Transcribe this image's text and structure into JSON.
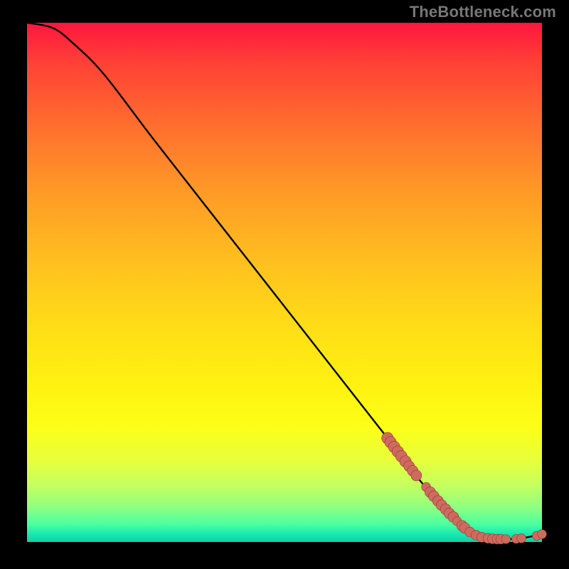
{
  "watermark": "TheBottleneck.com",
  "colors": {
    "frame_bg": "#000000",
    "curve": "#000000",
    "dot_fill": "#cf6a5e",
    "dot_stroke": "#8a3c33"
  },
  "chart_data": {
    "type": "line",
    "title": "",
    "xlabel": "",
    "ylabel": "",
    "xlim": [
      0,
      100
    ],
    "ylim": [
      0,
      100
    ],
    "grid": false,
    "series": [
      {
        "name": "curve",
        "x": [
          0,
          5,
          9,
          15,
          25,
          40,
          55,
          70,
          77,
          82,
          85,
          88,
          90,
          95,
          100
        ],
        "y": [
          100,
          99,
          96,
          90,
          77,
          58,
          39,
          20,
          11,
          6,
          3,
          1.5,
          0.8,
          0.6,
          1.5
        ]
      }
    ],
    "dots": [
      {
        "x": 70.0,
        "y": 20.0,
        "r": 1.4
      },
      {
        "x": 70.6,
        "y": 19.2,
        "r": 1.4
      },
      {
        "x": 71.3,
        "y": 18.3,
        "r": 1.4
      },
      {
        "x": 72.0,
        "y": 17.4,
        "r": 1.4
      },
      {
        "x": 72.7,
        "y": 16.5,
        "r": 1.4
      },
      {
        "x": 73.5,
        "y": 15.5,
        "r": 1.4
      },
      {
        "x": 74.2,
        "y": 14.6,
        "r": 1.3
      },
      {
        "x": 74.9,
        "y": 13.7,
        "r": 1.3
      },
      {
        "x": 75.6,
        "y": 12.8,
        "r": 1.3
      },
      {
        "x": 77.5,
        "y": 10.6,
        "r": 1.1
      },
      {
        "x": 78.3,
        "y": 9.6,
        "r": 1.3
      },
      {
        "x": 79.0,
        "y": 8.8,
        "r": 1.3
      },
      {
        "x": 79.8,
        "y": 7.9,
        "r": 1.3
      },
      {
        "x": 80.5,
        "y": 7.1,
        "r": 1.3
      },
      {
        "x": 81.3,
        "y": 6.3,
        "r": 1.3
      },
      {
        "x": 82.0,
        "y": 5.5,
        "r": 1.3
      },
      {
        "x": 82.8,
        "y": 4.8,
        "r": 1.3
      },
      {
        "x": 83.5,
        "y": 4.0,
        "r": 1.1
      },
      {
        "x": 84.5,
        "y": 3.1,
        "r": 1.3
      },
      {
        "x": 85.0,
        "y": 2.7,
        "r": 1.3
      },
      {
        "x": 86.0,
        "y": 1.9,
        "r": 1.2
      },
      {
        "x": 87.2,
        "y": 1.3,
        "r": 1.2
      },
      {
        "x": 88.3,
        "y": 0.9,
        "r": 1.2
      },
      {
        "x": 89.5,
        "y": 0.7,
        "r": 1.2
      },
      {
        "x": 90.4,
        "y": 0.6,
        "r": 1.2
      },
      {
        "x": 91.3,
        "y": 0.55,
        "r": 1.2
      },
      {
        "x": 92.0,
        "y": 0.55,
        "r": 1.2
      },
      {
        "x": 93.0,
        "y": 0.55,
        "r": 1.1
      },
      {
        "x": 95.0,
        "y": 0.6,
        "r": 1.1
      },
      {
        "x": 96.0,
        "y": 0.7,
        "r": 1.1
      },
      {
        "x": 99.0,
        "y": 1.2,
        "r": 1.1
      },
      {
        "x": 100.0,
        "y": 1.5,
        "r": 1.1
      }
    ]
  }
}
